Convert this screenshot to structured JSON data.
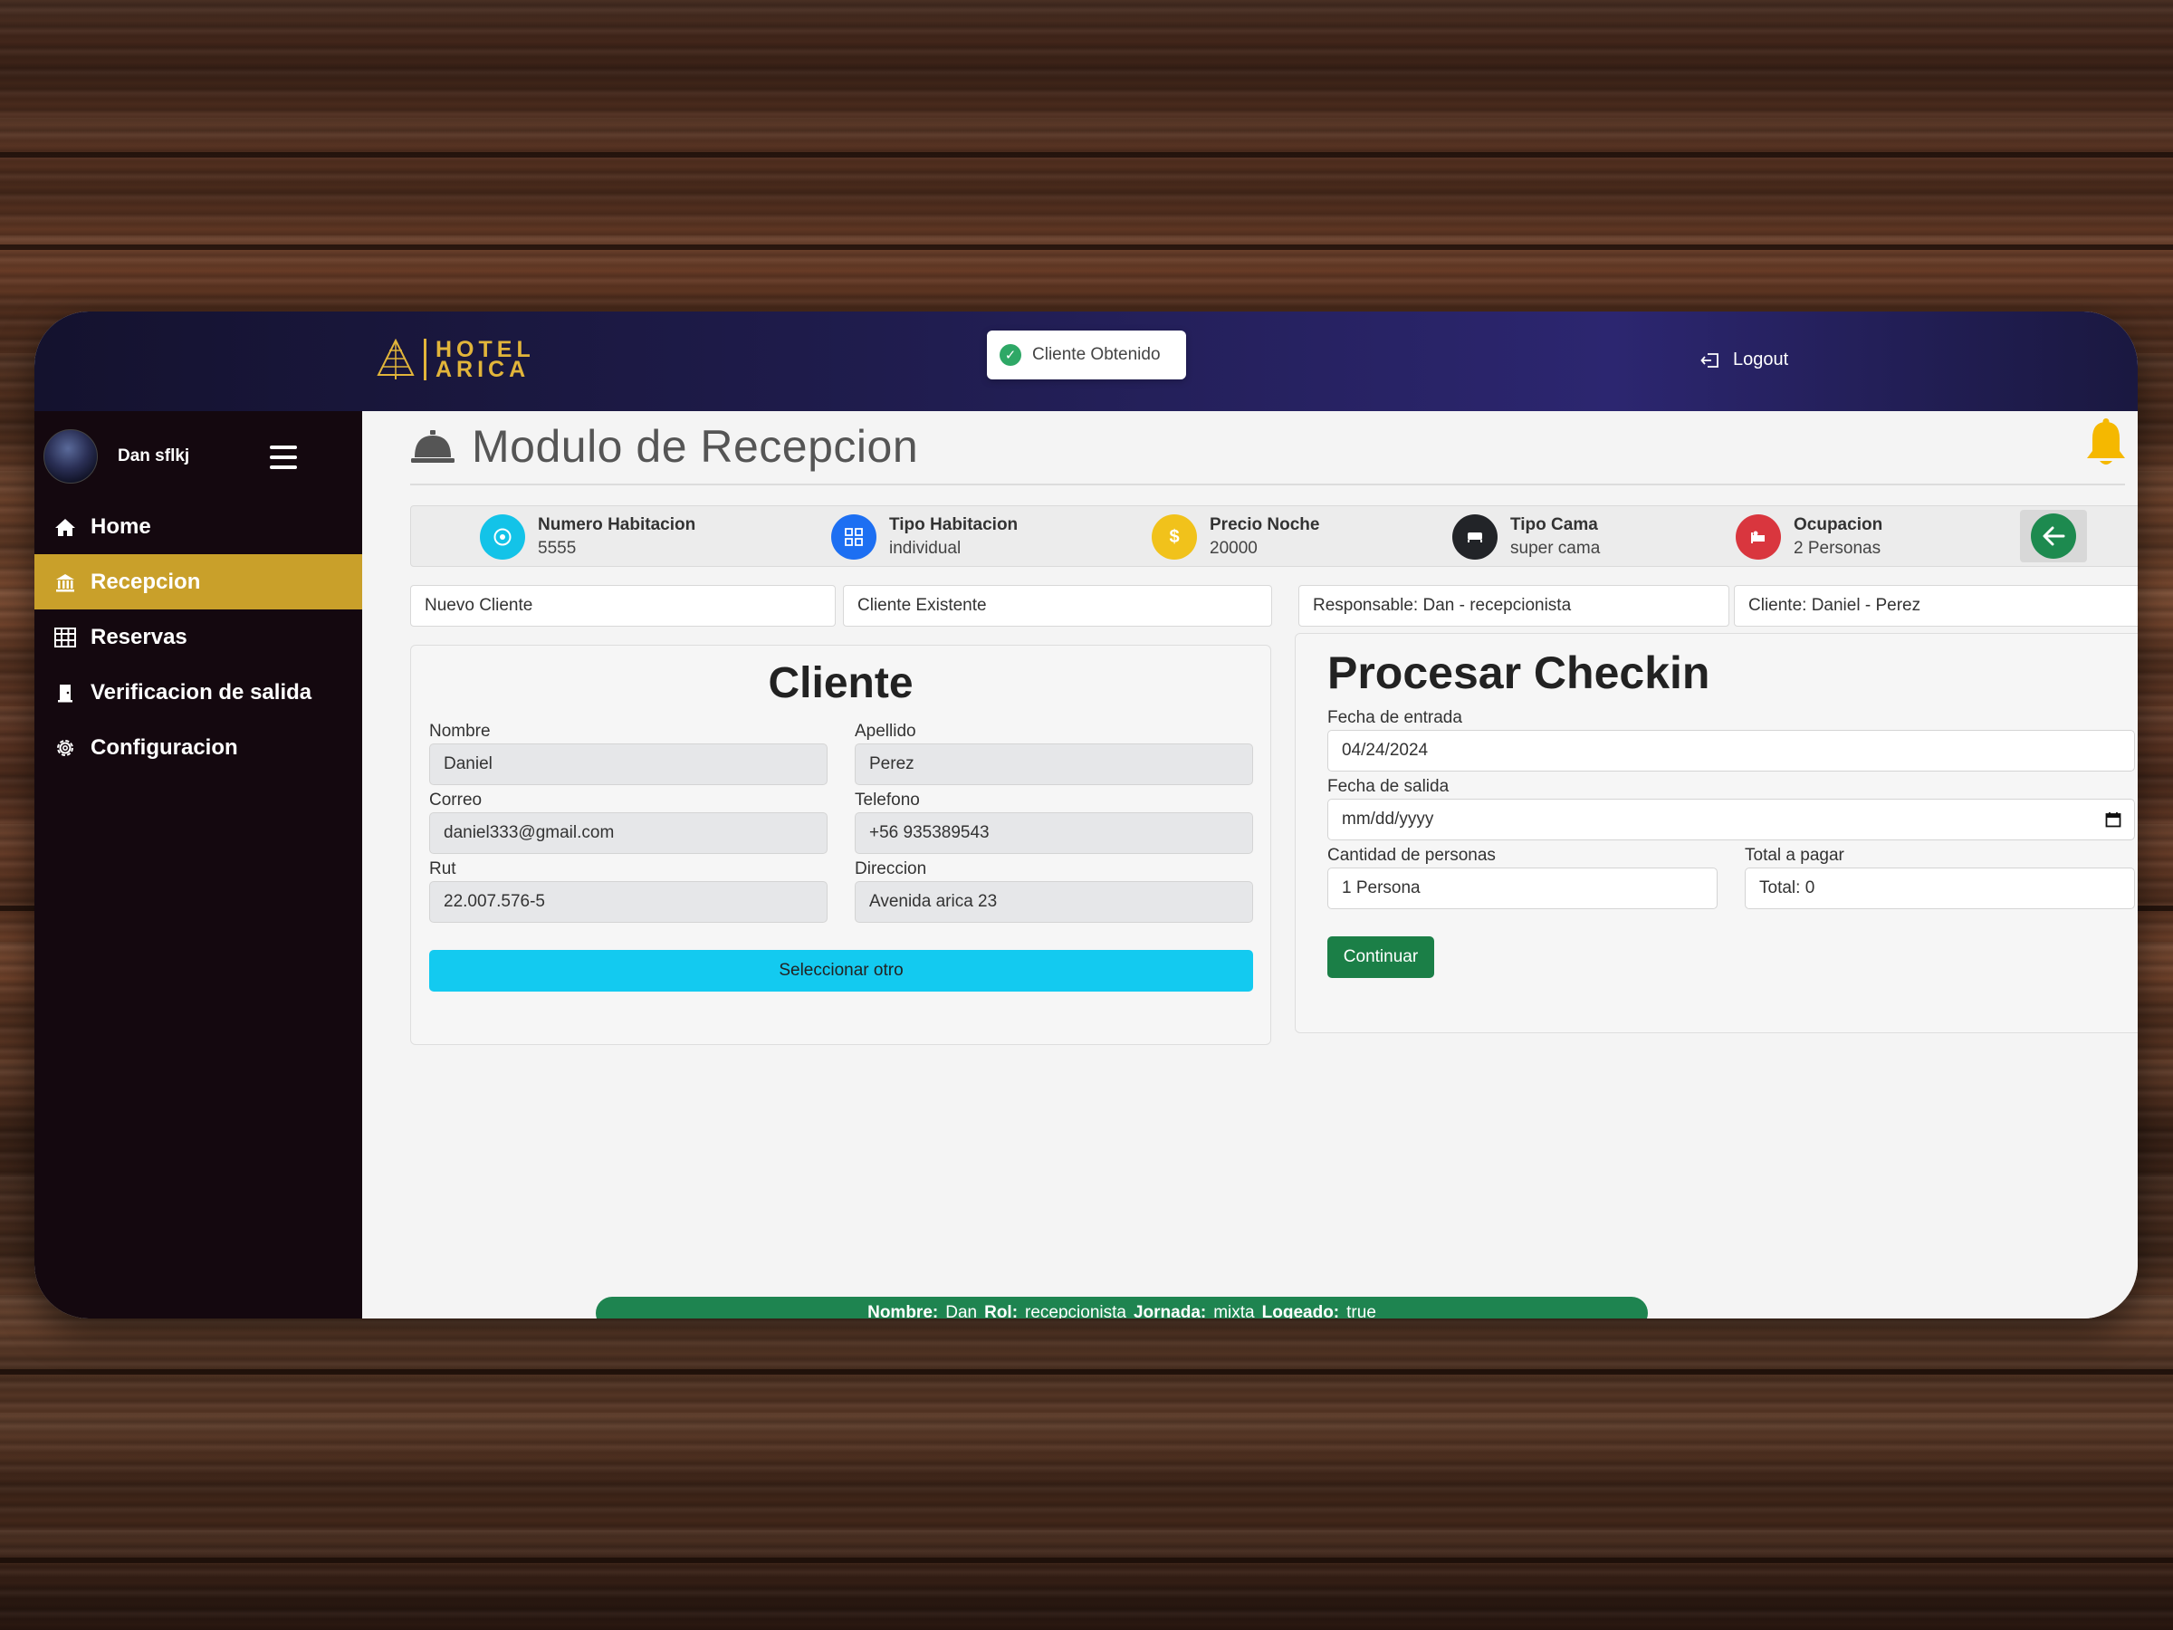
{
  "header": {
    "logo_line1": "HOTEL",
    "logo_line2": "ARICA",
    "toast_text": "Cliente Obtenido",
    "logout_label": "Logout"
  },
  "sidebar": {
    "user_name": "Dan sflkj",
    "items": [
      {
        "label": "Home",
        "icon": "home-icon"
      },
      {
        "label": "Recepcion",
        "icon": "bank-icon"
      },
      {
        "label": "Reservas",
        "icon": "table-icon"
      },
      {
        "label": "Verificacion de salida",
        "icon": "door-icon"
      },
      {
        "label": "Configuracion",
        "icon": "gear-icon"
      }
    ],
    "active_index": 1
  },
  "page": {
    "title": "Modulo de Recepcion"
  },
  "room_info": [
    {
      "label": "Numero Habitacion",
      "value": "5555",
      "icon": "target-icon",
      "color": "#13c3e8"
    },
    {
      "label": "Tipo Habitacion",
      "value": "individual",
      "icon": "grid-icon",
      "color": "#1d6ff2"
    },
    {
      "label": "Precio Noche",
      "value": "20000",
      "icon": "dollar-icon",
      "color": "#f1c21b"
    },
    {
      "label": "Tipo Cama",
      "value": "super cama",
      "icon": "bed-icon",
      "color": "#222428"
    },
    {
      "label": "Ocupacion",
      "value": "2 Personas",
      "icon": "people-icon",
      "color": "#d9363e"
    }
  ],
  "tabs": {
    "nuevo_cliente": "Nuevo Cliente",
    "cliente_existente": "Cliente Existente",
    "responsable": "Responsable: Dan - recepcionista",
    "cliente": "Cliente: Daniel - Perez"
  },
  "cliente_card": {
    "title": "Cliente",
    "fields": {
      "nombre": {
        "label": "Nombre",
        "value": "Daniel"
      },
      "apellido": {
        "label": "Apellido",
        "value": "Perez"
      },
      "correo": {
        "label": "Correo",
        "value": "daniel333@gmail.com"
      },
      "telefono": {
        "label": "Telefono",
        "value": "+56 935389543"
      },
      "rut": {
        "label": "Rut",
        "value": "22.007.576-5"
      },
      "direccion": {
        "label": "Direccion",
        "value": "Avenida arica 23"
      }
    },
    "select_other_label": "Seleccionar otro"
  },
  "checkin_card": {
    "title": "Procesar Checkin",
    "fecha_entrada_label": "Fecha de entrada",
    "fecha_entrada_value": "04/24/2024",
    "fecha_salida_label": "Fecha de salida",
    "fecha_salida_placeholder": "mm/dd/yyyy",
    "cantidad_label": "Cantidad de personas",
    "cantidad_value": "1 Persona",
    "total_label": "Total a pagar",
    "total_value": "Total: 0",
    "continue_label": "Continuar"
  },
  "status_bar": {
    "nombre_key": "Nombre:",
    "nombre_val": "Dan",
    "rol_key": "Rol:",
    "rol_val": "recepcionista",
    "jornada_key": "Jornada:",
    "jornada_val": "mixta",
    "logeado_key": "Logeado:",
    "logeado_val": "true"
  },
  "colors": {
    "sidebar_active": "#c9a02a",
    "sidebar_bg": "#14080f",
    "header_bg": "#1f1c4d",
    "primary_green": "#1b7f47",
    "cyan_button": "#13caf0",
    "logo_gold": "#e2b53a",
    "alert_bell": "#f5b800"
  }
}
